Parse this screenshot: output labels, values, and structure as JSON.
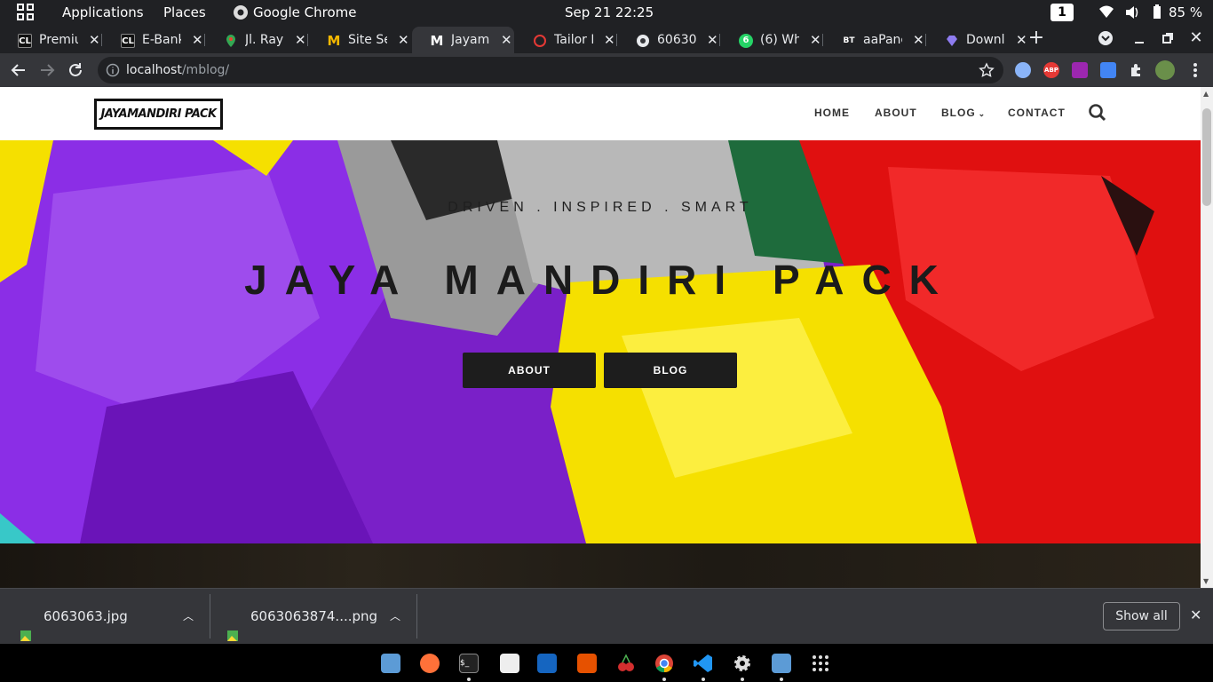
{
  "system_bar": {
    "applications": "Applications",
    "places": "Places",
    "active_app": "Google Chrome",
    "clock": "Sep 21  22:25",
    "workspace": "1",
    "battery": "85 %"
  },
  "tabs": [
    {
      "icon_text": "CL",
      "title": "Premium"
    },
    {
      "icon_text": "CL",
      "title": "E-Bank"
    },
    {
      "icon_text": "",
      "title": "Jl. Raya"
    },
    {
      "icon_text": "M",
      "title": "Site Set"
    },
    {
      "icon_text": "M",
      "title": "Jayama"
    },
    {
      "icon_text": "",
      "title": "Tailor E"
    },
    {
      "icon_text": "",
      "title": "60630"
    },
    {
      "icon_text": "6",
      "title": "(6) Wh"
    },
    {
      "icon_text": "BT",
      "title": "aaPane"
    },
    {
      "icon_text": "",
      "title": "Downl"
    }
  ],
  "toolbar": {
    "url_host": "localhost",
    "url_path": "/mblog/"
  },
  "site": {
    "logo": "JAYAMANDIRI PACK",
    "nav": [
      "HOME",
      "ABOUT",
      "BLOG",
      "CONTACT"
    ],
    "tagline": "DRIVEN . INSPIRED . SMART",
    "title": "JAYA MANDIRI PACK",
    "btn_about": "ABOUT",
    "btn_blog": "BLOG"
  },
  "downloads": {
    "items": [
      "6063063.jpg",
      "6063063874....png"
    ],
    "show_all": "Show all"
  },
  "colors": {
    "chrome_dark": "#202124",
    "chrome_toolbar": "#35363a",
    "hero_purple": "#8a2be2",
    "hero_yellow": "#f5e000",
    "hero_red": "#e01010"
  }
}
